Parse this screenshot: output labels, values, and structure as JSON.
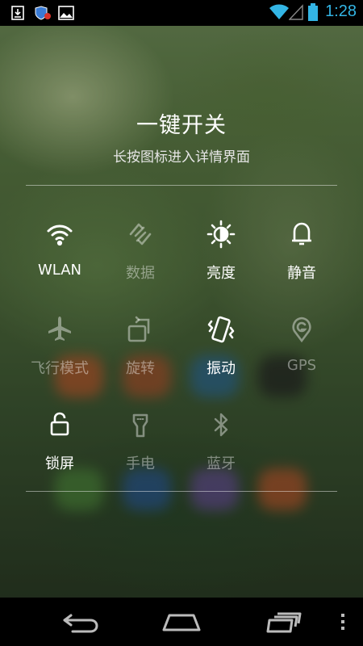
{
  "status_bar": {
    "time": "1:28",
    "icons": [
      "download-icon",
      "shield-notification-icon",
      "image-icon",
      "wifi-icon",
      "signal-icon",
      "battery-icon"
    ]
  },
  "header": {
    "title": "一键开关",
    "subtitle": "长按图标进入详情界面"
  },
  "toggles": [
    {
      "label": "WLAN",
      "icon": "wifi-icon",
      "on": true
    },
    {
      "label": "数据",
      "icon": "data-sync-icon",
      "on": false
    },
    {
      "label": "亮度",
      "icon": "brightness-icon",
      "on": true
    },
    {
      "label": "静音",
      "icon": "bell-icon",
      "on": true
    },
    {
      "label": "飞行模式",
      "icon": "airplane-icon",
      "on": false
    },
    {
      "label": "旋转",
      "icon": "rotate-icon",
      "on": false
    },
    {
      "label": "振动",
      "icon": "vibrate-icon",
      "on": true
    },
    {
      "label": "GPS",
      "icon": "gps-icon",
      "on": false
    },
    {
      "label": "锁屏",
      "icon": "lock-icon",
      "on": true
    },
    {
      "label": "手电",
      "icon": "flashlight-icon",
      "on": false
    },
    {
      "label": "蓝牙",
      "icon": "bluetooth-icon",
      "on": false
    }
  ],
  "nav_bar": {
    "icons": [
      "back-icon",
      "home-icon",
      "recents-icon",
      "menu-icon"
    ]
  },
  "colors": {
    "status_accent": "#33b5e5",
    "toggle_on": "#ffffff",
    "toggle_off": "rgba(255,255,255,0.42)"
  }
}
